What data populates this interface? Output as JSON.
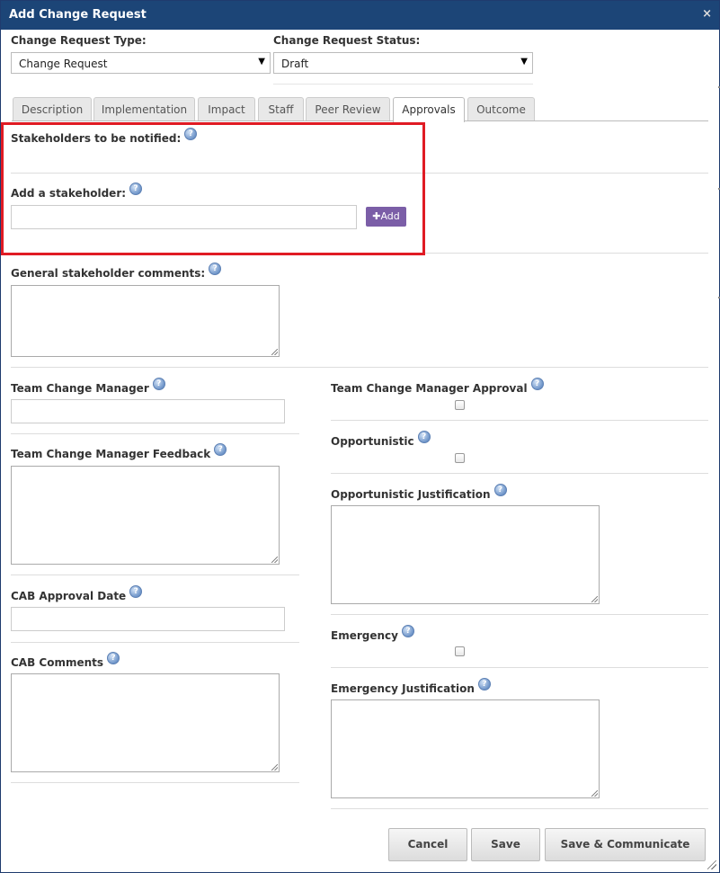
{
  "dialog": {
    "title": "Add Change Request",
    "close_glyph": "×"
  },
  "type_field": {
    "label": "Change Request Type:",
    "value": "Change Request",
    "arrow": "▼"
  },
  "status_field": {
    "label": "Change Request Status:",
    "value": "Draft",
    "arrow": "▼"
  },
  "tabs": [
    {
      "label": "Description"
    },
    {
      "label": "Implementation"
    },
    {
      "label": "Impact"
    },
    {
      "label": "Staff"
    },
    {
      "label": "Peer Review"
    },
    {
      "label": "Approvals",
      "active": true
    },
    {
      "label": "Outcome"
    }
  ],
  "approvals": {
    "stakeholders_label": "Stakeholders to be notified:",
    "add_stakeholder_label": "Add a stakeholder:",
    "add_button": "Add",
    "add_button_icon": "plus-icon",
    "general_comments_label": "General stakeholder comments:",
    "team_change_manager_label": "Team Change Manager",
    "team_change_manager_feedback_label": "Team Change Manager Feedback",
    "cab_approval_date_label": "CAB Approval Date",
    "cab_comments_label": "CAB Comments",
    "team_change_manager_approval_label": "Team Change Manager Approval",
    "opportunistic_label": "Opportunistic",
    "opportunistic_justification_label": "Opportunistic Justification",
    "emergency_label": "Emergency",
    "emergency_justification_label": "Emergency Justification"
  },
  "help_glyph": "?",
  "footer": {
    "cancel": "Cancel",
    "save": "Save",
    "save_communicate": "Save & Communicate"
  },
  "colors": {
    "titlebar": "#1c4577",
    "add_button": "#7b5ea7",
    "highlight": "#e01b24"
  }
}
